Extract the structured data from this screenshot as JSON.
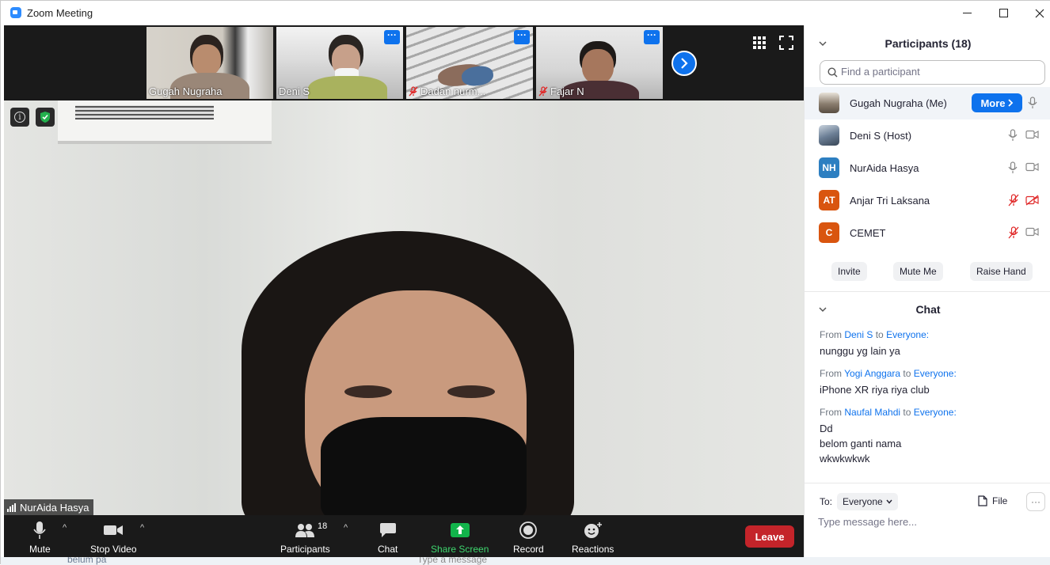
{
  "window": {
    "title": "Zoom Meeting"
  },
  "thumbnails": [
    {
      "name": "Gugah Nugraha",
      "muted": false,
      "has_menu": false
    },
    {
      "name": "Deni S",
      "muted": false,
      "has_menu": true
    },
    {
      "name": "Dadan nurm...",
      "muted": true,
      "has_menu": true
    },
    {
      "name": "Fajar N",
      "muted": true,
      "has_menu": true
    }
  ],
  "main_video": {
    "speaker_name": "NurAida Hasya"
  },
  "toolbar": {
    "mute": "Mute",
    "stop_video": "Stop Video",
    "participants": "Participants",
    "participants_count": "18",
    "chat": "Chat",
    "share_screen": "Share Screen",
    "record": "Record",
    "reactions": "Reactions",
    "leave": "Leave"
  },
  "participants_panel": {
    "title": "Participants (18)",
    "search_placeholder": "Find a participant",
    "more_label": "More",
    "list": [
      {
        "name": "Gugah Nugraha (Me)",
        "initials": "",
        "avatar_color": "#8a7d6e"
      },
      {
        "name": "Deni S (Host)",
        "initials": "",
        "avatar_color": "#6c7f96"
      },
      {
        "name": "NurAida Hasya",
        "initials": "NH",
        "avatar_color": "#2d7fc1"
      },
      {
        "name": "Anjar Tri Laksana",
        "initials": "AT",
        "avatar_color": "#d9550f"
      },
      {
        "name": "CEMET",
        "initials": "C",
        "avatar_color": "#d9550f"
      }
    ],
    "buttons": {
      "invite": "Invite",
      "mute_me": "Mute Me",
      "raise_hand": "Raise Hand"
    }
  },
  "chat_panel": {
    "title": "Chat",
    "messages": [
      {
        "from_prefix": "From ",
        "sender": "Deni S",
        "to_word": " to ",
        "recipient": "Everyone:",
        "lines": [
          "nunggu yg lain ya"
        ]
      },
      {
        "from_prefix": "From ",
        "sender": "Yogi Anggara",
        "to_word": " to ",
        "recipient": "Everyone:",
        "lines": [
          "iPhone XR riya riya club"
        ]
      },
      {
        "from_prefix": "From ",
        "sender": "Naufal Mahdi",
        "to_word": " to ",
        "recipient": "Everyone:",
        "lines": [
          "Dd",
          "belom ganti nama",
          "wkwkwkwk"
        ]
      }
    ],
    "to_label": "To:",
    "to_value": "Everyone",
    "file_label": "File",
    "more_label": "···",
    "input_placeholder": "Type message here..."
  },
  "background_strip": {
    "left_text": "belum pa",
    "right_text": "Type a message"
  },
  "colors": {
    "accent": "#0e72ed",
    "leave": "#c4242a",
    "share": "#12b44b",
    "muted_red": "#e02828"
  }
}
